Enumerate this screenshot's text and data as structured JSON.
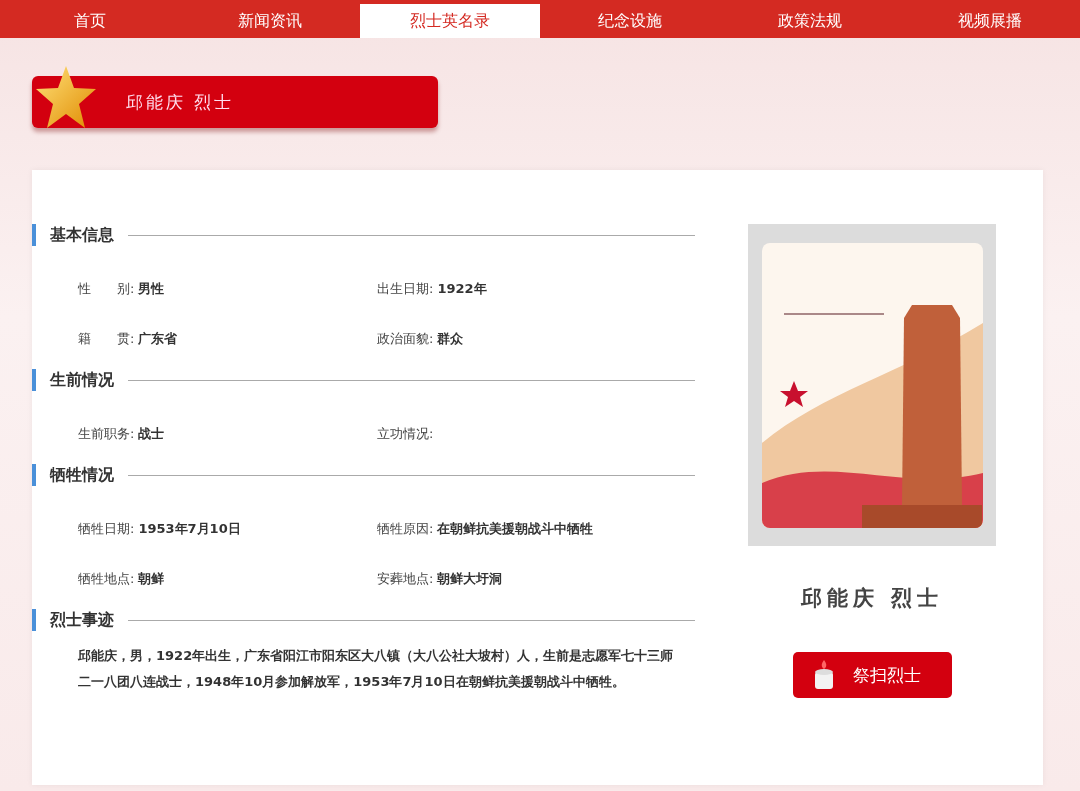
{
  "nav": {
    "tabs": [
      {
        "label": "首页",
        "selected": false
      },
      {
        "label": "新闻资讯",
        "selected": false
      },
      {
        "label": "烈士英名录",
        "selected": true
      },
      {
        "label": "纪念设施",
        "selected": false
      },
      {
        "label": "政策法规",
        "selected": false
      },
      {
        "label": "视频展播",
        "selected": false
      }
    ]
  },
  "banner": {
    "title": "邱能庆 烈士"
  },
  "sections": [
    {
      "title": "基本信息",
      "kind": "fields",
      "fields": [
        {
          "label": "性　　别:",
          "value": "男性"
        },
        {
          "label": "出生日期:",
          "value": "1922年"
        },
        {
          "label": "籍　　贯:",
          "value": "广东省"
        },
        {
          "label": "政治面貌:",
          "value": "群众"
        }
      ]
    },
    {
      "title": "生前情况",
      "kind": "fields",
      "fields": [
        {
          "label": "生前职务:",
          "value": "战士"
        },
        {
          "label": "立功情况:"
        }
      ]
    },
    {
      "title": "牺牲情况",
      "kind": "fields",
      "fields": [
        {
          "label": "牺牲日期:",
          "value": "1953年7月10日"
        },
        {
          "label": "牺牲原因:",
          "value": "在朝鲜抗美援朝战斗中牺牲"
        },
        {
          "label": "牺牲地点:",
          "value": "朝鲜"
        },
        {
          "label": "安葬地点:",
          "value": "朝鲜大圩洞"
        }
      ]
    },
    {
      "title": "烈士事迹",
      "kind": "text",
      "text": "邱能庆，男，1922年出生，广东省阳江市阳东区大八镇（大八公社大坡村）人，生前是志愿军七十三师二一八团八连战士，1948年10月参加解放军，1953年7月10日在朝鲜抗美援朝战斗中牺牲。"
    }
  ],
  "profile": {
    "name": "邱能庆 烈士",
    "button": "祭扫烈士"
  }
}
